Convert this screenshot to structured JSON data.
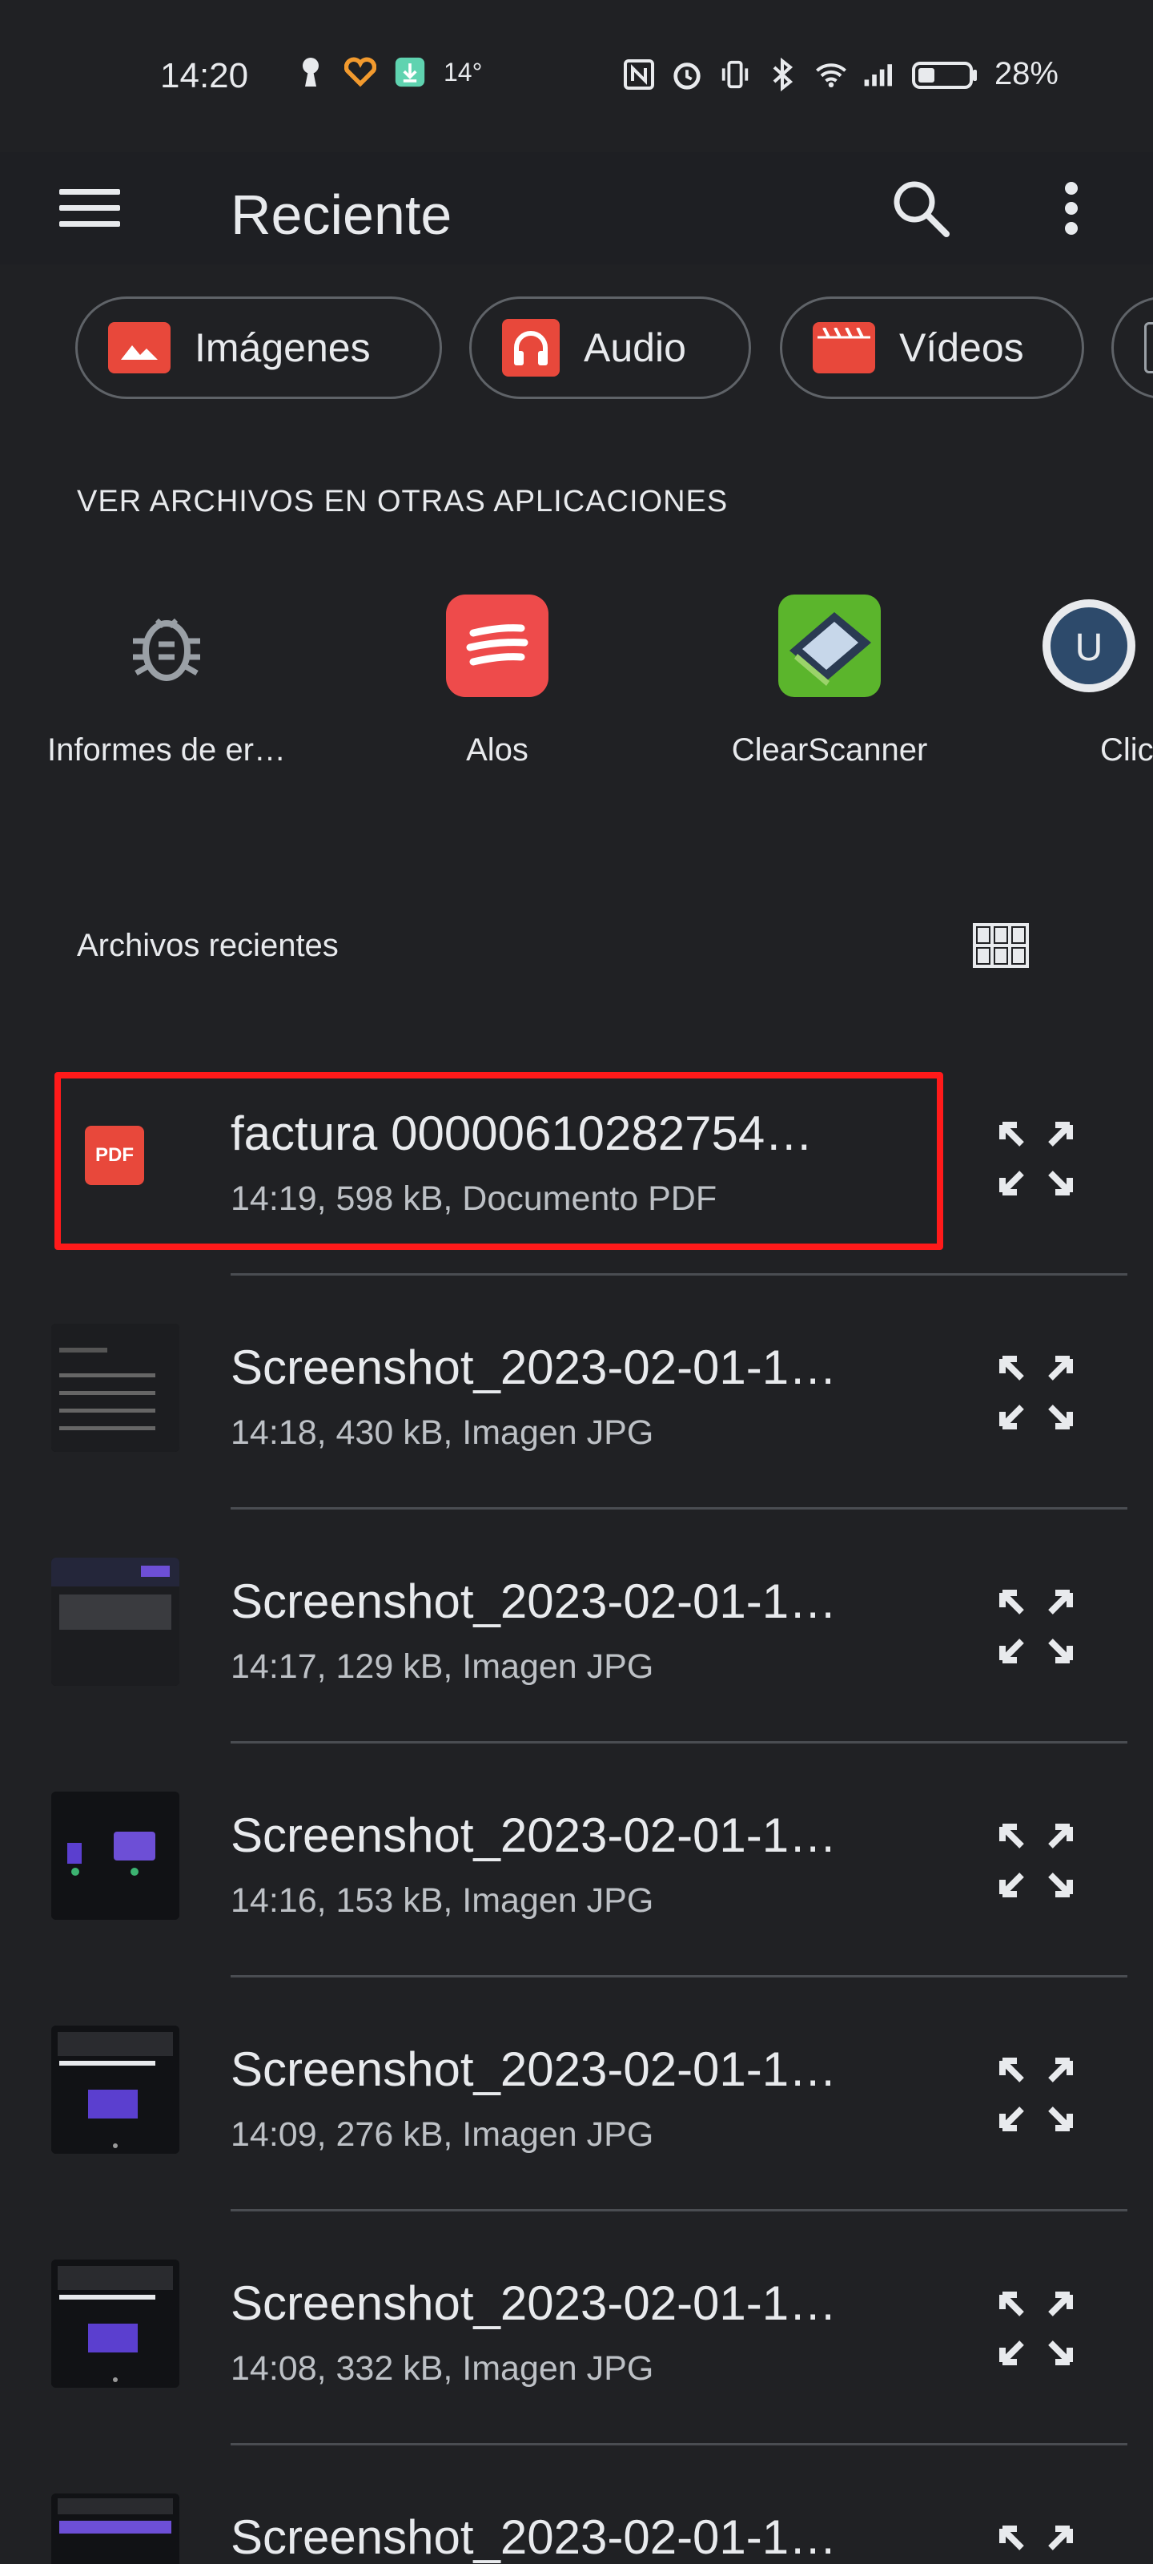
{
  "status": {
    "time": "14:20",
    "temperature": "14°",
    "battery": "28%"
  },
  "appbar": {
    "title": "Reciente",
    "menu_icon": "hamburger-menu-icon",
    "search_icon": "search-icon",
    "more_icon": "more-vert-icon"
  },
  "chips": [
    {
      "label": "Imágenes",
      "icon": "image-icon"
    },
    {
      "label": "Audio",
      "icon": "headphones-icon"
    },
    {
      "label": "Vídeos",
      "icon": "movie-icon"
    }
  ],
  "apps_section": {
    "title": "VER ARCHIVOS EN OTRAS APLICACIONES",
    "apps": [
      {
        "label": "Informes de er…",
        "icon": "bug-icon"
      },
      {
        "label": "Alos",
        "icon": "alos-app-icon"
      },
      {
        "label": "ClearScanner",
        "icon": "clearscanner-app-icon"
      },
      {
        "label": "Clic",
        "icon": "clic-app-icon"
      }
    ]
  },
  "recent": {
    "title": "Archivos recientes",
    "grid_icon": "grid-view-icon",
    "files": [
      {
        "name": "factura 00000610282754…",
        "meta": "14:19, 598 kB, Documento PDF",
        "icon": "pdf-icon",
        "pdf_label": "PDF"
      },
      {
        "name": "Screenshot_2023-02-01-1…",
        "meta": "14:18, 430 kB, Imagen JPG"
      },
      {
        "name": "Screenshot_2023-02-01-1…",
        "meta": "14:17, 129 kB, Imagen JPG"
      },
      {
        "name": "Screenshot_2023-02-01-1…",
        "meta": "14:16, 153 kB, Imagen JPG"
      },
      {
        "name": "Screenshot_2023-02-01-1…",
        "meta": "14:09, 276 kB, Imagen JPG"
      },
      {
        "name": "Screenshot_2023-02-01-1…",
        "meta": "14:08, 332 kB, Imagen JPG"
      },
      {
        "name": "Screenshot_2023-02-01-1…",
        "meta": ""
      }
    ]
  },
  "colors": {
    "background": "#202124",
    "accent_red": "#e8483b",
    "highlight_border": "#ff1a1a"
  }
}
